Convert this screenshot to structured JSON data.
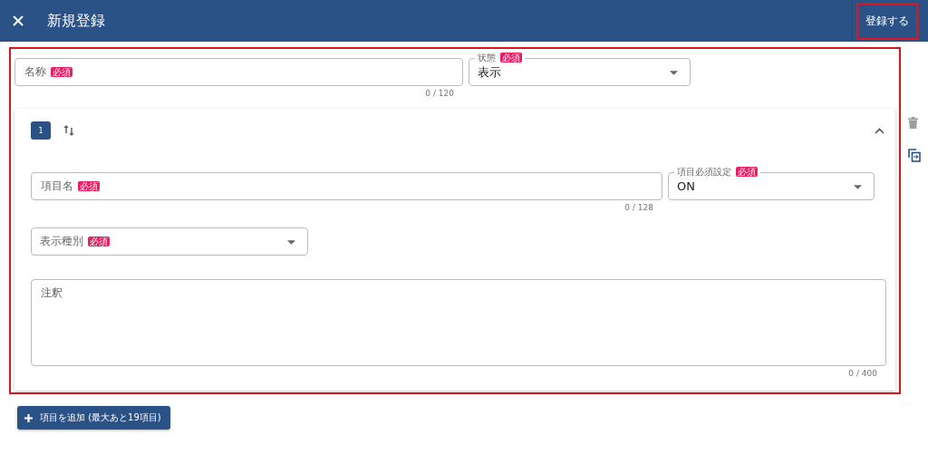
{
  "header": {
    "title": "新規登録",
    "save_button": "登録する"
  },
  "name_field": {
    "label": "名称",
    "badge": "必須",
    "counter": "0 / 120"
  },
  "status_select": {
    "label": "状態",
    "badge": "必須",
    "value": "表示"
  },
  "items": [
    {
      "number": "1",
      "expanded": true,
      "name_field": {
        "label": "項目名",
        "badge": "必須",
        "counter": "0 / 128"
      },
      "required_select": {
        "label": "項目必須設定",
        "badge": "必須",
        "value": "ON"
      },
      "display_type_select": {
        "label": "表示種別",
        "badge": "必須"
      },
      "note_field": {
        "placeholder": "注釈",
        "counter": "0 / 400"
      }
    }
  ],
  "add_button": "項目を追加 (最大あと19項目)"
}
